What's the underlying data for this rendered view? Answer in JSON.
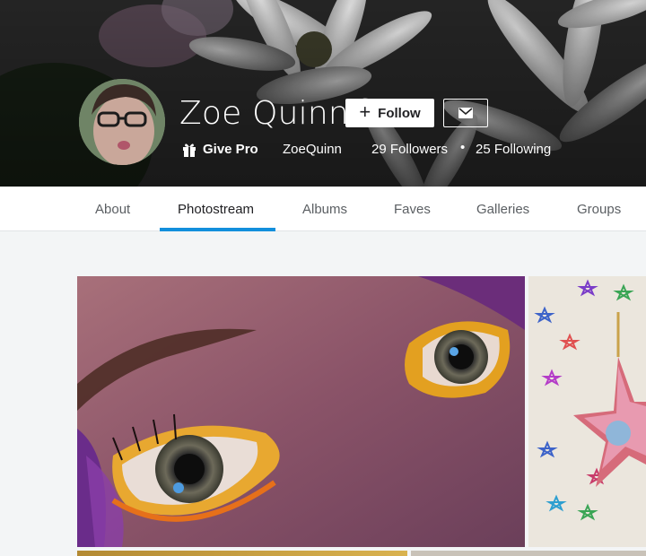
{
  "profile": {
    "name": "Zoe Quinn",
    "username": "ZoeQuinn",
    "followers": "29 Followers",
    "separator": "•",
    "following": "25 Following"
  },
  "actions": {
    "follow_label": "Follow",
    "give_pro_label": "Give Pro"
  },
  "icons": {
    "follow": "plus-icon",
    "message": "mail-icon",
    "give_pro": "gift-icon"
  },
  "tabs": [
    {
      "label": "About"
    },
    {
      "label": "Photostream",
      "active": true
    },
    {
      "label": "Albums"
    },
    {
      "label": "Faves"
    },
    {
      "label": "Galleries"
    },
    {
      "label": "Groups"
    }
  ],
  "colors": {
    "accent": "#128fdc",
    "tab_active": "#212124",
    "tab_inactive": "#5b5f63"
  }
}
